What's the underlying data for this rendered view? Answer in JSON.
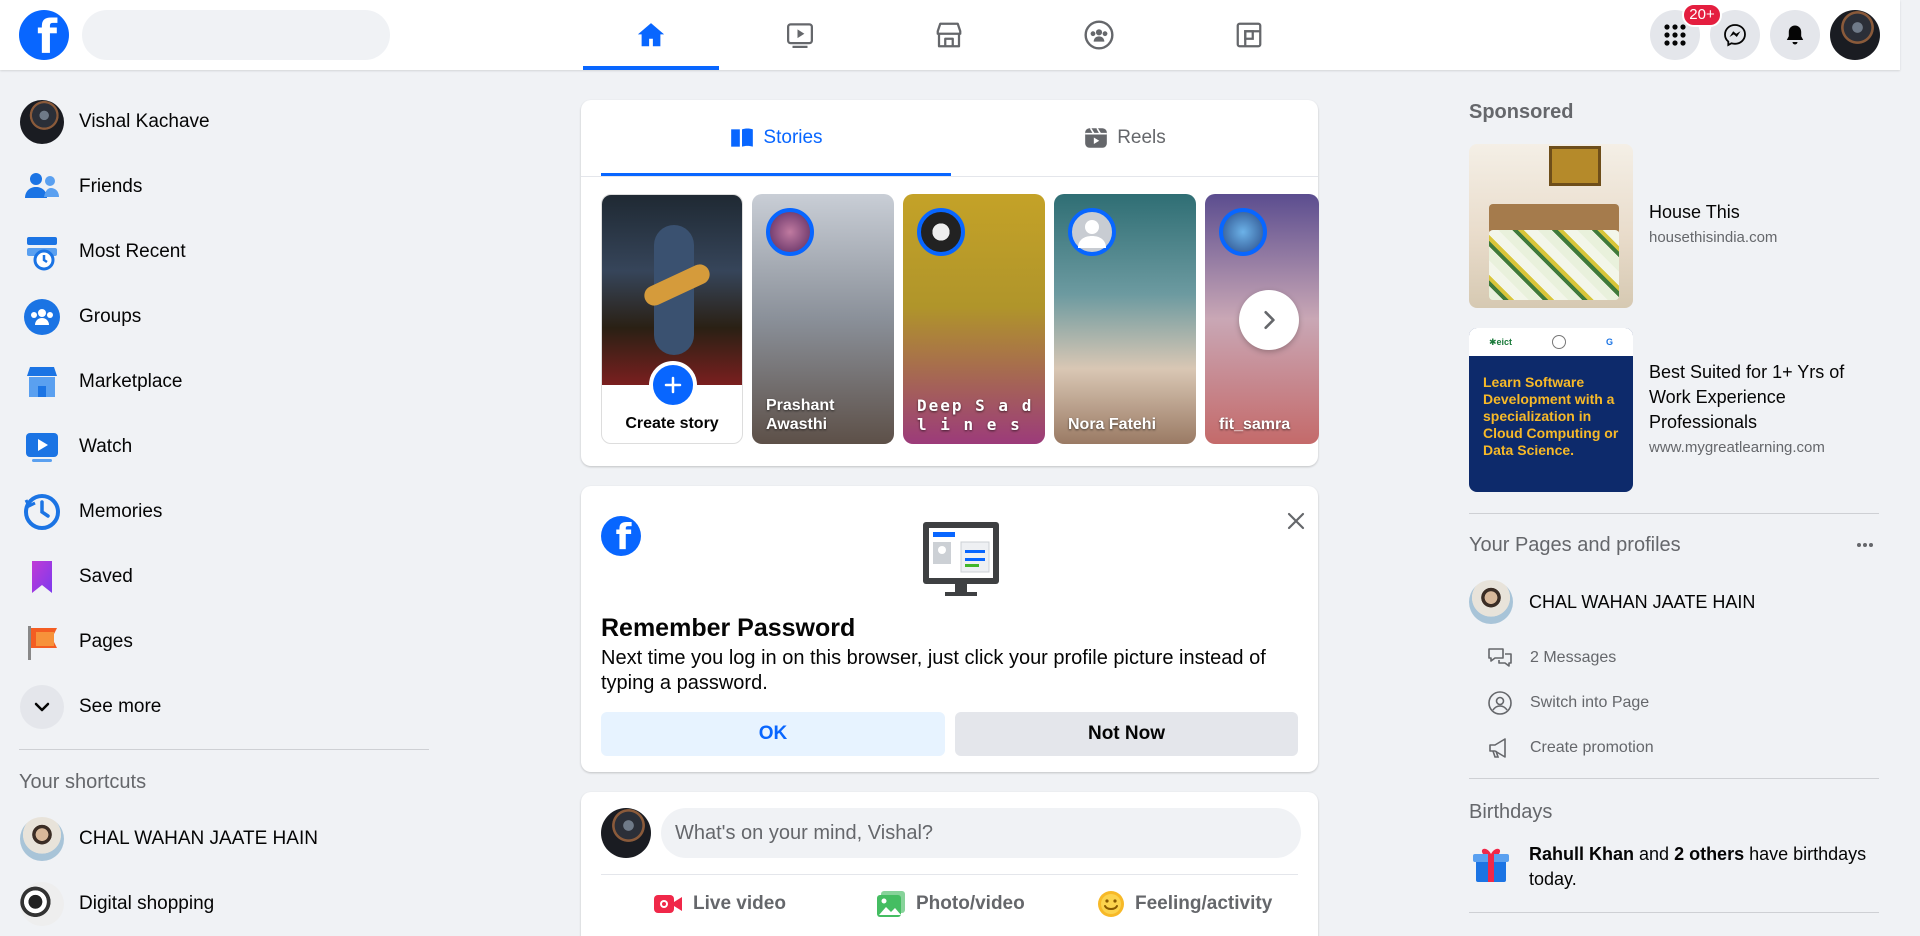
{
  "colors": {
    "brand": "#0866ff",
    "badge": "#e41e3f",
    "page_bg": "#f0f2f5",
    "secondary_text": "#65676b"
  },
  "topbar": {
    "logo_letter": "f",
    "search_placeholder": "",
    "nav_tabs": [
      {
        "icon": "home-icon",
        "active": true
      },
      {
        "icon": "watch-icon",
        "active": false
      },
      {
        "icon": "marketplace-icon",
        "active": false
      },
      {
        "icon": "groups-icon",
        "active": false
      },
      {
        "icon": "gaming-icon",
        "active": false
      }
    ],
    "notifications_badge": "20+"
  },
  "left_sidebar": {
    "items": [
      {
        "label": "Vishal Kachave",
        "icon": "profile-avatar"
      },
      {
        "label": "Friends",
        "icon": "friends-icon"
      },
      {
        "label": "Most Recent",
        "icon": "most-recent-icon"
      },
      {
        "label": "Groups",
        "icon": "groups-icon"
      },
      {
        "label": "Marketplace",
        "icon": "marketplace-icon"
      },
      {
        "label": "Watch",
        "icon": "watch-icon"
      },
      {
        "label": "Memories",
        "icon": "memories-icon"
      },
      {
        "label": "Saved",
        "icon": "saved-icon"
      },
      {
        "label": "Pages",
        "icon": "pages-icon"
      },
      {
        "label": "See more",
        "icon": "chevron-down-icon"
      }
    ],
    "shortcuts_title": "Your shortcuts",
    "shortcuts": [
      {
        "label": "CHAL WAHAN JAATE HAIN"
      },
      {
        "label": "Digital shopping"
      }
    ]
  },
  "stories_card": {
    "tabs": [
      {
        "label": "Stories",
        "active": true
      },
      {
        "label": "Reels",
        "active": false
      }
    ],
    "create_story_label": "Create story",
    "stories": [
      {
        "name": "Prashant Awasthi"
      },
      {
        "name": "Deep S a d l i n e s"
      },
      {
        "name": "Nora Fatehi"
      },
      {
        "name": "fit_samra"
      }
    ]
  },
  "remember_password": {
    "title": "Remember Password",
    "body": "Next time you log in on this browser, just click your profile picture instead of typing a password.",
    "ok_label": "OK",
    "not_now_label": "Not Now"
  },
  "composer": {
    "placeholder": "What's on your mind, Vishal?",
    "actions": [
      {
        "label": "Live video",
        "icon": "live-video-icon",
        "color": "#f02849"
      },
      {
        "label": "Photo/video",
        "icon": "photo-icon",
        "color": "#45bd62"
      },
      {
        "label": "Feeling/activity",
        "icon": "feeling-icon",
        "color": "#f7b928"
      }
    ]
  },
  "right_sidebar": {
    "sponsored_title": "Sponsored",
    "ads": [
      {
        "title": "House This",
        "url": "housethisindia.com"
      },
      {
        "title": "Best Suited for 1+ Yrs of Work Experience Professionals",
        "url": "www.mygreatlearning.com",
        "image_text": "Learn Software Development with a specialization in Cloud Computing or Data Science."
      }
    ],
    "pages_title": "Your Pages and profiles",
    "page_name": "CHAL WAHAN JAATE HAIN",
    "page_actions": [
      {
        "label": "2 Messages",
        "icon": "messages-icon"
      },
      {
        "label": "Switch into Page",
        "icon": "switch-profile-icon"
      },
      {
        "label": "Create promotion",
        "icon": "megaphone-icon"
      }
    ],
    "birthdays_title": "Birthdays",
    "birthday_name": "Rahull Khan",
    "birthday_and": " and ",
    "birthday_others": "2 others",
    "birthday_suffix": " have birthdays today."
  }
}
